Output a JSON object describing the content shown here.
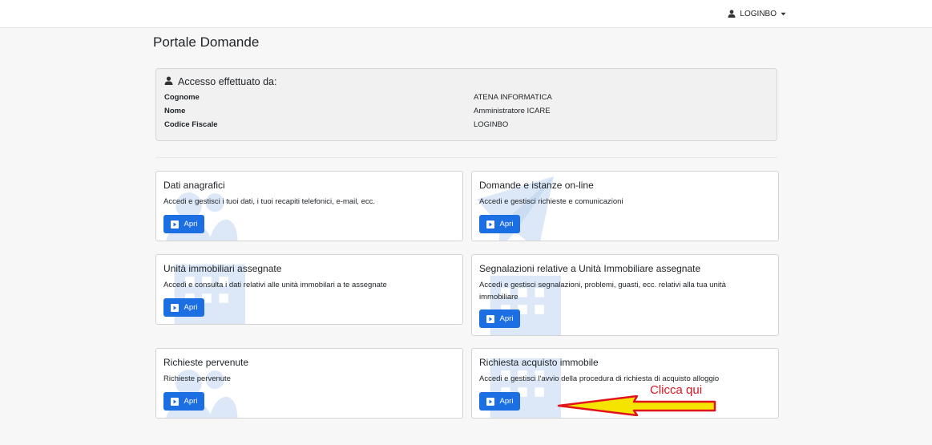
{
  "header": {
    "user_label": "LOGINBO",
    "icons": {
      "user": "user-icon",
      "caret": "caret-down-icon"
    }
  },
  "page": {
    "title": "Portale Domande"
  },
  "access": {
    "heading": "Accesso effettuato da:",
    "rows": [
      {
        "label": "Cognome",
        "value": "ATENA INFORMATICA"
      },
      {
        "label": "Nome",
        "value": "Amministratore ICARE"
      },
      {
        "label": "Codice Fiscale",
        "value": "LOGINBO"
      }
    ]
  },
  "cards": [
    {
      "title": "Dati anagrafici",
      "desc": "Accedi e gestisci i tuoi dati, i tuoi recapiti telefonici, e-mail, ecc.",
      "button": "Apri",
      "watermark": "users-icon"
    },
    {
      "title": "Domande e istanze on-line",
      "desc": "Accedi e gestisci richieste e comunicazioni",
      "button": "Apri",
      "watermark": "paper-plane-icon"
    },
    {
      "title": "Unità immobiliari assegnate",
      "desc": "Accedi e consulta i dati relativi alle unità immobilari a te assegnate",
      "button": "Apri",
      "watermark": "building-icon"
    },
    {
      "title": "Segnalazioni relative a Unità Immobiliare assegnate",
      "desc": "Accedi e gestisci segnalazioni, problemi, guasti, ecc. relativi alla tua unità immobiliare",
      "button": "Apri",
      "watermark": "building-icon"
    },
    {
      "title": "Richieste pervenute",
      "desc": "Richieste pervenute",
      "button": "Apri",
      "watermark": "users-icon"
    },
    {
      "title": "Richiesta acquisto immobile",
      "desc": "Accedi e gestisci l'avvio della procedura di richiesta di acquisto alloggio",
      "button": "Apri",
      "watermark": "building-icon"
    }
  ],
  "annotation": {
    "text": "Clicca qui",
    "color": "#e0141e",
    "arrow_fill": "#f5e400"
  },
  "theme": {
    "primary": "#1b6fe3",
    "watermark": "#dce8f7"
  }
}
